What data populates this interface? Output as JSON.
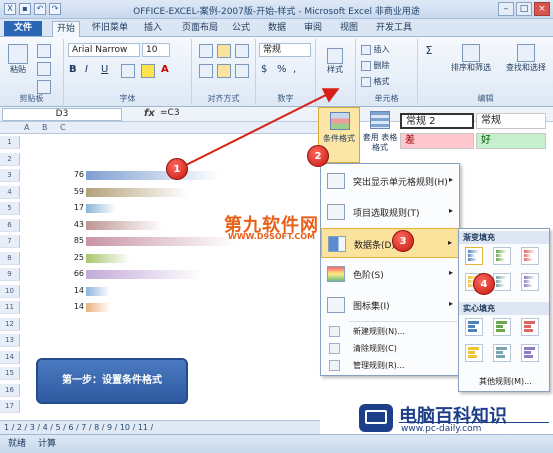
{
  "window": {
    "title": "OFFICE-EXCEL-案例-2007版-开始-样式 - Microsoft Excel 非商业用途"
  },
  "tabs": [
    "开始",
    "怀旧菜单",
    "插入",
    "页面布局",
    "公式",
    "数据",
    "审阅",
    "视图",
    "开发工具"
  ],
  "file_tab": "文件",
  "ribbon": {
    "paste": "粘贴",
    "font_name": "Arial Narrow",
    "font_size": "10",
    "number_format": "常规",
    "styles_btn": "样式",
    "insert": "插入",
    "delete": "删除",
    "format": "格式",
    "sort_filter": "排序和筛选",
    "find_select": "查找和选择",
    "groups": [
      "剪贴板",
      "字体",
      "对齐方式",
      "数字",
      "单元格",
      "编辑"
    ]
  },
  "formula_bar": {
    "name_box": "D3",
    "fx": "fx",
    "formula": "=C3"
  },
  "styles_panel": {
    "cond_format": "条件格式",
    "table_format": "套用\n表格格式",
    "cells": [
      "常规 2",
      "常规",
      "差",
      "好"
    ]
  },
  "columns": [
    "A",
    "B",
    "C"
  ],
  "rows": [
    "1",
    "2",
    "3",
    "4",
    "5",
    "6",
    "7",
    "8",
    "9",
    "10",
    "11",
    "12",
    "13",
    "14",
    "15",
    "16",
    "17"
  ],
  "data_values": [
    "76",
    "59",
    "17",
    "43",
    "85",
    "25",
    "66",
    "14",
    "14"
  ],
  "bar_colors": [
    "#7f9fd2",
    "#b3a17a",
    "#88b5d9",
    "#c09595",
    "#c993a8",
    "#a6c66c",
    "#c3a9d9",
    "#8fb4de",
    "#e9b07b"
  ],
  "bar_levels": [
    0.89,
    0.69,
    0.2,
    0.51,
    1.0,
    0.29,
    0.78,
    0.16,
    0.16
  ],
  "step_label": "第一步：设置条件格式",
  "menu": {
    "items": [
      {
        "label": "突出显示单元格规则(H)",
        "arrow": "▸"
      },
      {
        "label": "项目选取规则(T)",
        "arrow": "▸"
      },
      {
        "label": "数据条(D)",
        "arrow": "▸"
      },
      {
        "label": "色阶(S)",
        "arrow": "▸"
      },
      {
        "label": "图标集(I)",
        "arrow": "▸"
      }
    ],
    "small": [
      "新建规则(N)...",
      "清除规则(C)",
      "管理规则(R)..."
    ]
  },
  "submenu": {
    "gradient": "渐变填充",
    "solid": "实心填充",
    "more": "其他规则(M)...",
    "colors": [
      "#4f81bd",
      "#6aa84f",
      "#e06666",
      "#f1c232",
      "#76a5af",
      "#8e7cc3"
    ]
  },
  "sheet_tabs": "1 / 2 / 3 / 4 / 5 / 6 / 7 / 8 / 9 / 10 / 11 /",
  "status": {
    "ready": "就绪",
    "calc": "计算"
  },
  "badges": [
    "1",
    "2",
    "3",
    "4"
  ],
  "watermark": {
    "brand": "第九软件网",
    "url": "WWW.D9SOFT.COM"
  },
  "logo": {
    "title": "电脑百科知识",
    "url": "www.pc-daily.com"
  }
}
